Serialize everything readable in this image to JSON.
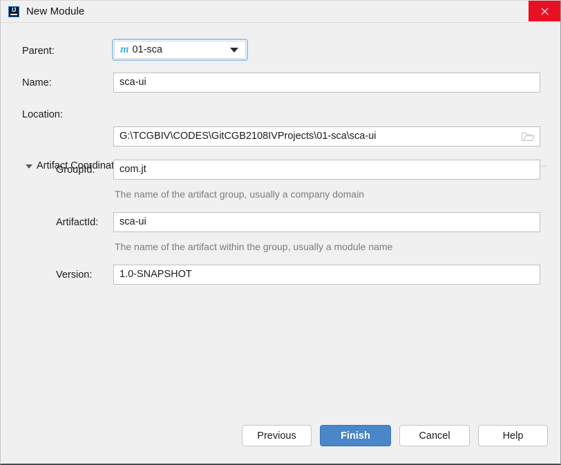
{
  "window": {
    "title": "New Module",
    "icon": "intellij-idea-icon",
    "close_label": "×"
  },
  "form": {
    "parent": {
      "label": "Parent:",
      "value": "01-sca",
      "icon": "maven-module-icon",
      "icon_glyph": "m"
    },
    "name": {
      "label": "Name:",
      "value": "sca-ui"
    },
    "location": {
      "label": "Location:",
      "value": "G:\\TCGBIV\\CODES\\GitCGB2108IVProjects\\01-sca\\sca-ui",
      "browse_icon": "folder-icon"
    }
  },
  "artifact_section": {
    "title": "Artifact Coordinates",
    "expanded": true,
    "fields": [
      {
        "label": "GroupId:",
        "value": "com.jt",
        "hint": "The name of the artifact group, usually a company domain"
      },
      {
        "label": "ArtifactId:",
        "value": "sca-ui",
        "hint": "The name of the artifact within the group, usually a module name"
      },
      {
        "label": "Version:",
        "value": "1.0-SNAPSHOT",
        "hint": ""
      }
    ]
  },
  "buttons": {
    "previous": "Previous",
    "finish": "Finish",
    "cancel": "Cancel",
    "help": "Help"
  },
  "colors": {
    "dialog_background": "#f0f0f0",
    "primary_button": "#4a86c8",
    "close_button": "#e81123",
    "focus_ring": "#9cc6ee",
    "maven_icon": "#3ab3e0",
    "hint_text": "#7c7c7c"
  }
}
